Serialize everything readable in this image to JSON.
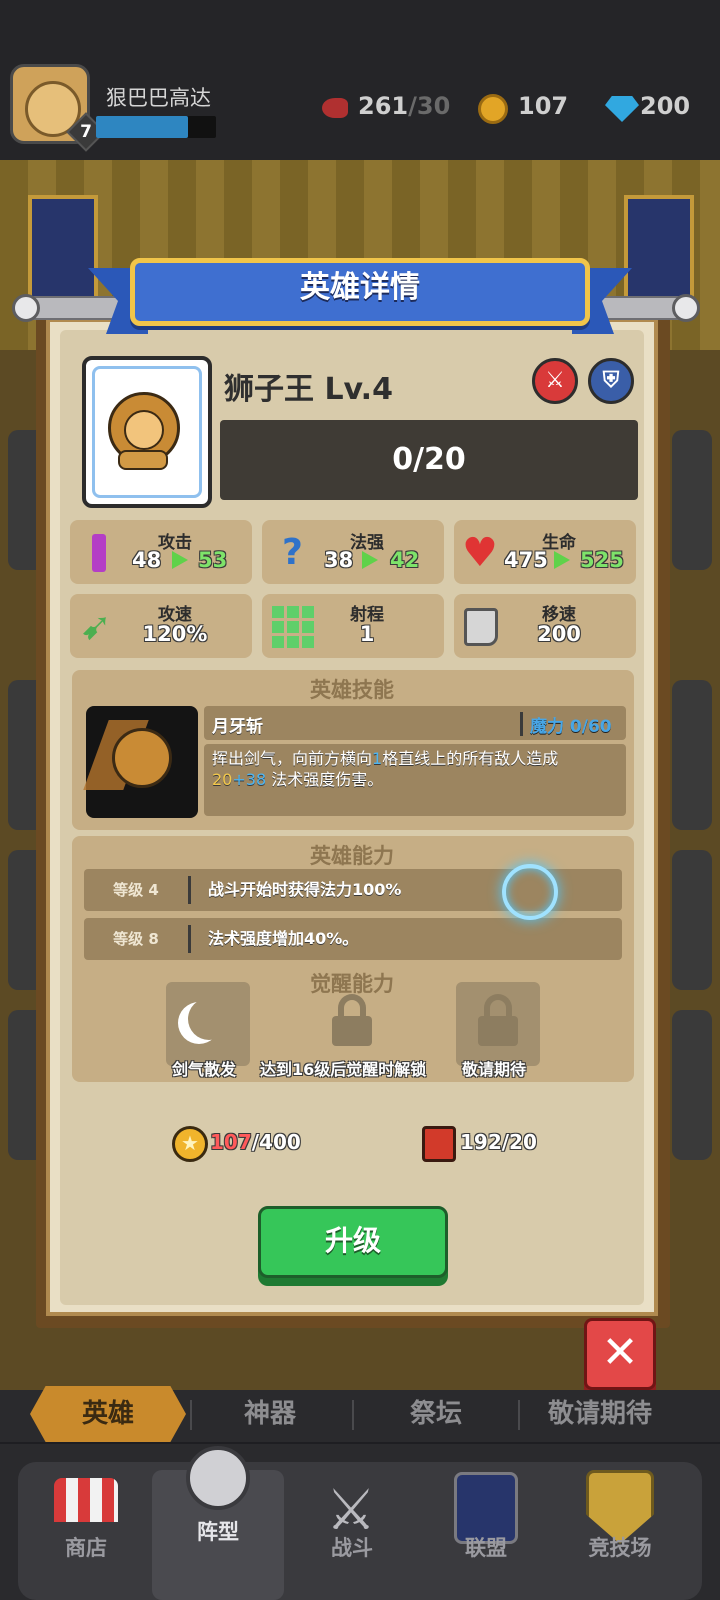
{
  "player": {
    "name": "狠巴巴高达",
    "level": "7"
  },
  "resources": {
    "stamina": "261",
    "stamina_max": "/30",
    "coins": "107",
    "gems": "200"
  },
  "dialog": {
    "title": "英雄详情"
  },
  "hero": {
    "name": "狮子王 Lv.4",
    "shards": "0/20",
    "class_icons": [
      "sword-class-icon",
      "shield-class-icon"
    ]
  },
  "stats": [
    {
      "label": "攻击",
      "value": "48",
      "next": "53",
      "icon": "sword-icon"
    },
    {
      "label": "法强",
      "value": "38",
      "next": "42",
      "icon": "staff-icon"
    },
    {
      "label": "生命",
      "value": "475",
      "next": "525",
      "icon": "heart-icon"
    },
    {
      "label": "攻速",
      "value": "120%",
      "icon": "bow-icon"
    },
    {
      "label": "射程",
      "value": "1",
      "icon": "grid-icon"
    },
    {
      "label": "移速",
      "value": "200",
      "icon": "boot-icon"
    }
  ],
  "skill": {
    "section_title": "英雄技能",
    "name": "月牙斩",
    "mana": "魔力 0/60",
    "desc_1": "挥出剑气，向前方横向",
    "desc_num_1": "1",
    "desc_2": "格直线上的所有敌人造成",
    "desc_base": "20",
    "desc_bonus": "+38",
    "desc_3": " 法术强度伤害。"
  },
  "abilities": {
    "section_title": "英雄能力",
    "rows": [
      {
        "level": "等级 4",
        "text": "战斗开始时获得法力100%"
      },
      {
        "level": "等级 8",
        "text": "法术强度增加40%。"
      }
    ]
  },
  "awaken": {
    "section_title": "觉醒能力",
    "slots": [
      {
        "label": "剑气散发",
        "icon": "crescent-slash-icon"
      },
      {
        "label": "达到16级后觉醒时解锁",
        "icon": "lock-icon"
      },
      {
        "label": "敬请期待",
        "icon": "lock-icon"
      }
    ]
  },
  "cost": {
    "coins_have": "107",
    "coins_need": "/400",
    "books_have": "192",
    "books_need": "/20"
  },
  "upgrade_label": "升级",
  "tabs": [
    "英雄",
    "神器",
    "祭坛",
    "敬请期待"
  ],
  "nav": [
    "商店",
    "阵型",
    "战斗",
    "联盟",
    "竞技场"
  ],
  "colors": {
    "accent_blue": "#3f6fd0",
    "upgrade_green": "#36c659",
    "close_red": "#e34848",
    "stat_up": "#7ee36a"
  }
}
